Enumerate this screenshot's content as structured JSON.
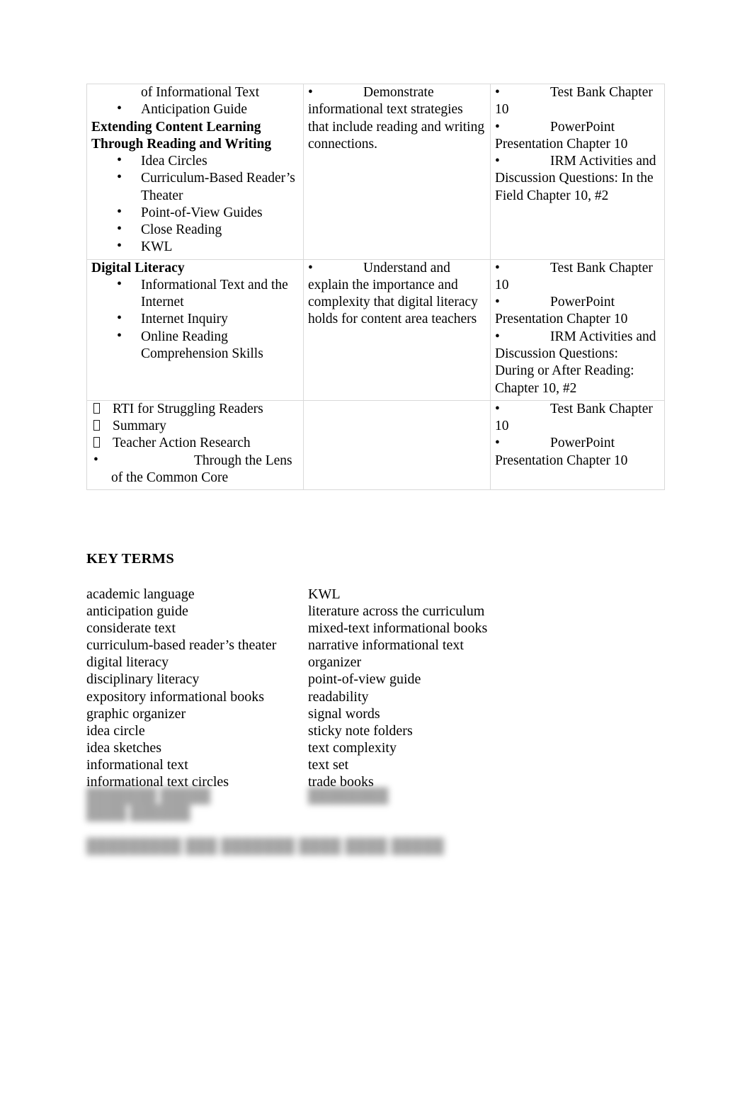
{
  "document": {
    "page_background": "#ffffff",
    "text_color": "#000000",
    "table_border_color": "#d9d9d9"
  },
  "table": {
    "rows": [
      {
        "id": "row-extending-content-learning",
        "column_a": {
          "orphan_line": "of Informational Text",
          "orphan_bullets": [
            "Anticipation Guide"
          ],
          "heading": "Extending Content Learning Through Reading and Writing",
          "bullets": [
            "Idea Circles",
            "Curriculum-Based Reader’s Theater",
            "Point-of-View Guides",
            "Close Reading",
            "KWL"
          ]
        },
        "column_b": {
          "bullets": [
            "Demonstrate informational text strategies that include reading and writing connections."
          ]
        },
        "column_c": {
          "bullets": [
            "Test Bank Chapter 10",
            "PowerPoint Presentation Chapter 10",
            "IRM Activities and Discussion Questions: In the Field Chapter 10, #2"
          ]
        }
      },
      {
        "id": "row-digital-literacy",
        "column_a": {
          "heading": "Digital Literacy",
          "bullets": [
            "Informational Text and the Internet",
            "Internet Inquiry",
            "Online Reading Comprehension Skills"
          ]
        },
        "column_b": {
          "bullets": [
            "Understand and explain the importance and complexity that digital literacy holds for content area teachers"
          ]
        },
        "column_c": {
          "bullets": [
            "Test Bank Chapter 10",
            "PowerPoint Presentation Chapter 10",
            "IRM Activities and Discussion Questions: During or After Reading: Chapter 10, #2"
          ]
        }
      },
      {
        "id": "row-rti-summary",
        "column_a": {
          "box_bullets": [
            "RTI for Struggling Readers",
            "Summary",
            "Teacher Action Research"
          ],
          "round_bullets": [
            "Through the Lens of the Common Core"
          ]
        },
        "column_b": {
          "bullets": []
        },
        "column_c": {
          "bullets": [
            "Test Bank Chapter 10",
            "PowerPoint Presentation Chapter 10"
          ]
        }
      }
    ]
  },
  "key_terms": {
    "heading": "KEY TERMS",
    "left_column": [
      "academic language",
      "anticipation guide",
      "considerate text",
      "curriculum-based reader’s theater",
      "digital literacy",
      "disciplinary literacy",
      "expository informational books",
      "graphic organizer",
      "idea circle",
      "idea sketches",
      "informational text",
      "informational text circles"
    ],
    "right_column": [
      "KWL",
      "literature across the curriculum",
      "mixed-text informational books",
      "narrative informational text",
      "organizer",
      "point-of-view guide",
      "readability",
      "signal words",
      "sticky note folders",
      "text complexity",
      "text set",
      "trade books"
    ]
  },
  "obscured": {
    "note": "illegible blurred text",
    "left_lines": [
      "███████ █████",
      "████ ██████"
    ],
    "right_lines": [
      "████████"
    ],
    "heading_line": "█████████ ███ ███████ ████ ████ █████"
  }
}
